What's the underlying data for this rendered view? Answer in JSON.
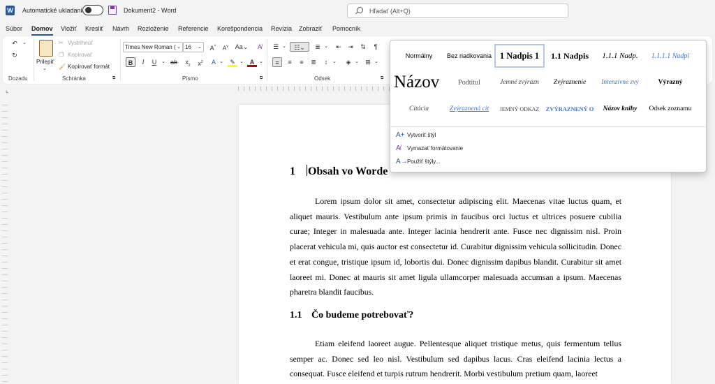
{
  "titlebar": {
    "app_letter": "W",
    "autosave_label": "Automatické ukladanie",
    "document_title": "Dokument2  -  Word",
    "search_placeholder": "Hľadať (Alt+Q)"
  },
  "tabs": [
    "Súbor",
    "Domov",
    "Vložiť",
    "Kresliť",
    "Návrh",
    "Rozloženie",
    "Referencie",
    "Korešpondencia",
    "Revízia",
    "Zobraziť",
    "Pomocník"
  ],
  "active_tab": "Domov",
  "ribbon": {
    "undo_group_label": "Dozadu",
    "clipboard": {
      "paste_label": "Prilepiť",
      "cut_label": "Vystrihnúť",
      "copy_label": "Kopírovať",
      "format_painter_label": "Kopírovať formát",
      "group_label": "Schránka"
    },
    "font": {
      "font_name": "Times New Roman (",
      "font_size": "16",
      "group_label": "Písmo"
    },
    "paragraph": {
      "group_label": "Odsek"
    }
  },
  "document": {
    "heading1_number": "1",
    "heading1_text": "Obsah vo Worde",
    "paragraph1": "Lorem ipsum dolor sit amet, consectetur adipiscing elit. Maecenas vitae luctus quam, et aliquet mauris. Vestibulum ante ipsum primis in faucibus orci luctus et ultrices posuere cubilia curae; Integer in malesuada ante. Integer lacinia hendrerit ante. Fusce nec dignissim nisl. Proin placerat vehicula mi, quis auctor est consectetur id. Curabitur dignissim vehicula sollicitudin. Donec et erat congue, tristique ipsum id, lobortis dui. Donec dignissim dapibus blandit. Curabitur sit amet laoreet mi. Donec at mauris sit amet ligula ullamcorper malesuada accumsan a ipsum. Maecenas pharetra blandit faucibus.",
    "heading2_number": "1.1",
    "heading2_text": "Čo budeme potrebovať?",
    "paragraph2": "Etiam eleifend laoreet augue. Pellentesque aliquet tristique metus, quis fermentum tellus semper ac. Donec sed leo nisl. Vestibulum sed dapibus lacus. Cras eleifend lacinia lectus a consequat. Fusce eleifend et turpis rutrum hendrerit. Morbi vestibulum pretium quam, laoreet"
  },
  "styles_gallery": {
    "styles": [
      "Normálny",
      "Bez riadkovania",
      "1  Nadpis 1",
      "1.1  Nadpis",
      "1.1.1  Nadp.",
      "1.1.1.1  Nadpi",
      "Názov",
      "Podtitul",
      "Jemné zvýrazn",
      "Zvýraznenie",
      "Intenzívne zvý",
      "Výrazný",
      "Citácia",
      "Zvýraznená cit",
      "Jemný odkaz",
      "Zvýraznený o",
      "Názov knihy",
      "Odsek zoznamu"
    ],
    "selected_style": "1  Nadpis 1",
    "commands": [
      "Vytvoriť štýl",
      "Vymazať formátovanie",
      "Použiť štýly..."
    ]
  },
  "colors": {
    "word_blue": "#2b579a",
    "highlight_yellow": "#ffff00",
    "font_color_red": "#c00000",
    "intense_style_blue": "#4472c4"
  }
}
